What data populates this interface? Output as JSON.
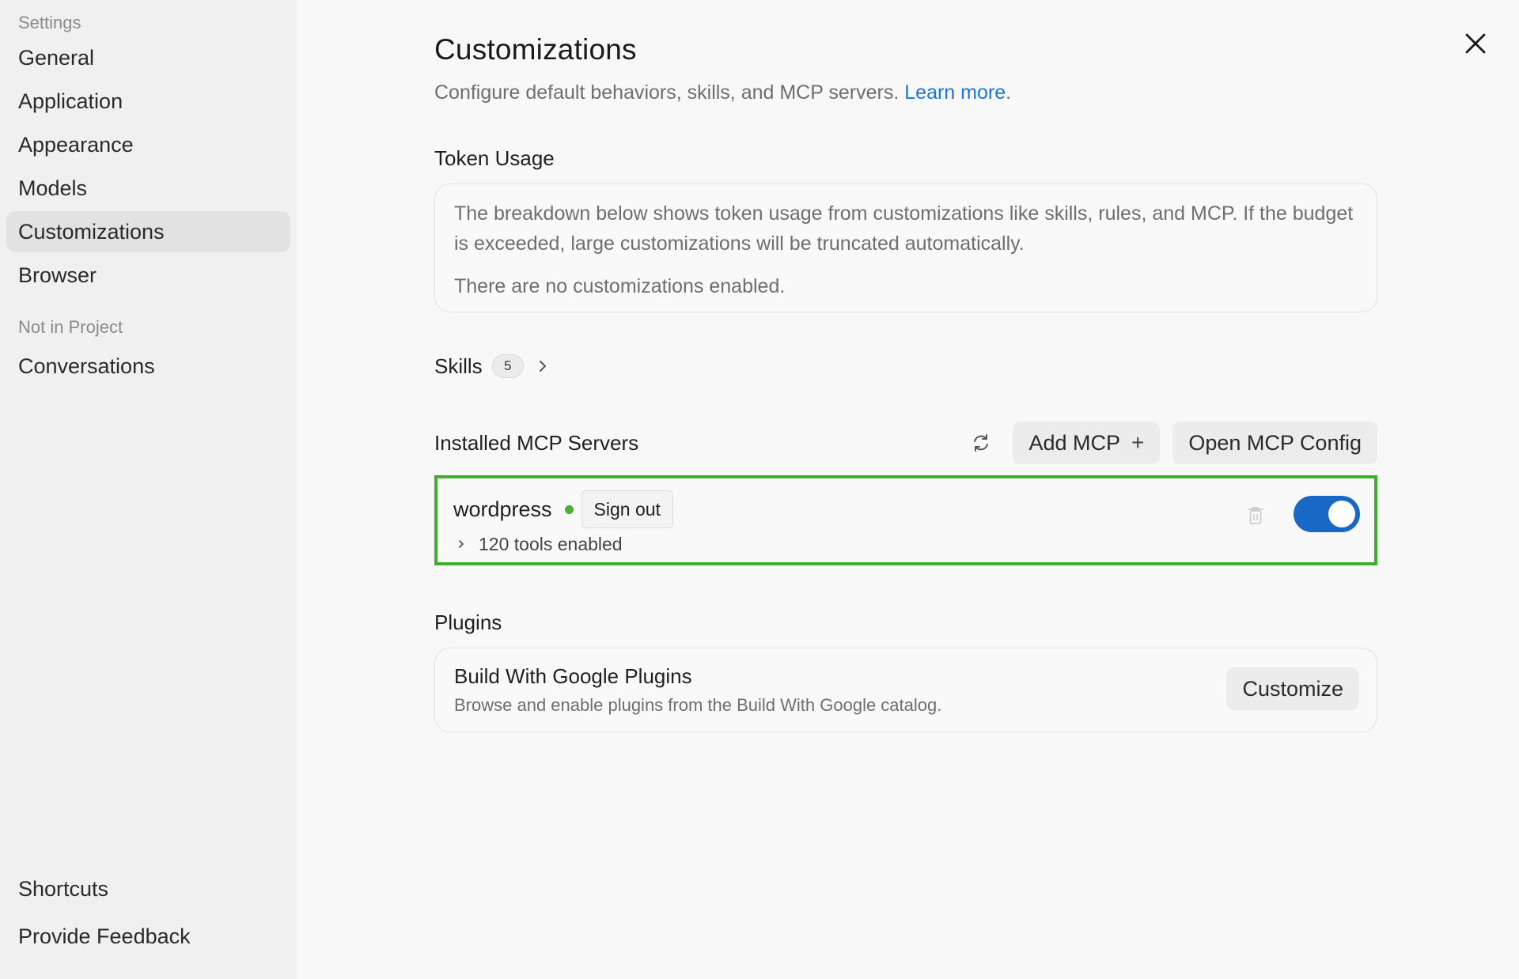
{
  "sidebar": {
    "header": "Settings",
    "items": [
      {
        "label": "General"
      },
      {
        "label": "Application"
      },
      {
        "label": "Appearance"
      },
      {
        "label": "Models"
      },
      {
        "label": "Customizations",
        "active": true
      },
      {
        "label": "Browser"
      }
    ],
    "section_label": "Not in Project",
    "project_items": [
      {
        "label": "Conversations"
      }
    ],
    "bottom_items": [
      {
        "label": "Shortcuts"
      },
      {
        "label": "Provide Feedback"
      }
    ]
  },
  "main": {
    "title": "Customizations",
    "subtitle": "Configure default behaviors, skills, and MCP servers.",
    "learn_more": "Learn more",
    "subtitle_end": ".",
    "token_usage": {
      "title": "Token Usage",
      "description": "The breakdown below shows token usage from customizations like skills, rules, and MCP. If the budget is exceeded, large customizations will be truncated automatically.",
      "empty_message": "There are no customizations enabled."
    },
    "skills": {
      "title": "Skills",
      "count": "5"
    },
    "mcp": {
      "title": "Installed MCP Servers",
      "add_label": "Add MCP",
      "add_icon": "+",
      "open_config_label": "Open MCP Config",
      "servers": [
        {
          "name": "wordpress",
          "status": "connected",
          "sign_out_label": "Sign out",
          "tools_text": "120 tools enabled",
          "enabled": true
        }
      ]
    },
    "plugins": {
      "title": "Plugins",
      "items": [
        {
          "name": "Build With Google Plugins",
          "description": "Browse and enable plugins from the Build With Google catalog.",
          "action_label": "Customize"
        }
      ]
    }
  },
  "colors": {
    "accent": "#1a73e8",
    "toggle_on": "#1769c5",
    "highlight_border": "#3cb02a",
    "status_connected": "#4cae3a"
  }
}
